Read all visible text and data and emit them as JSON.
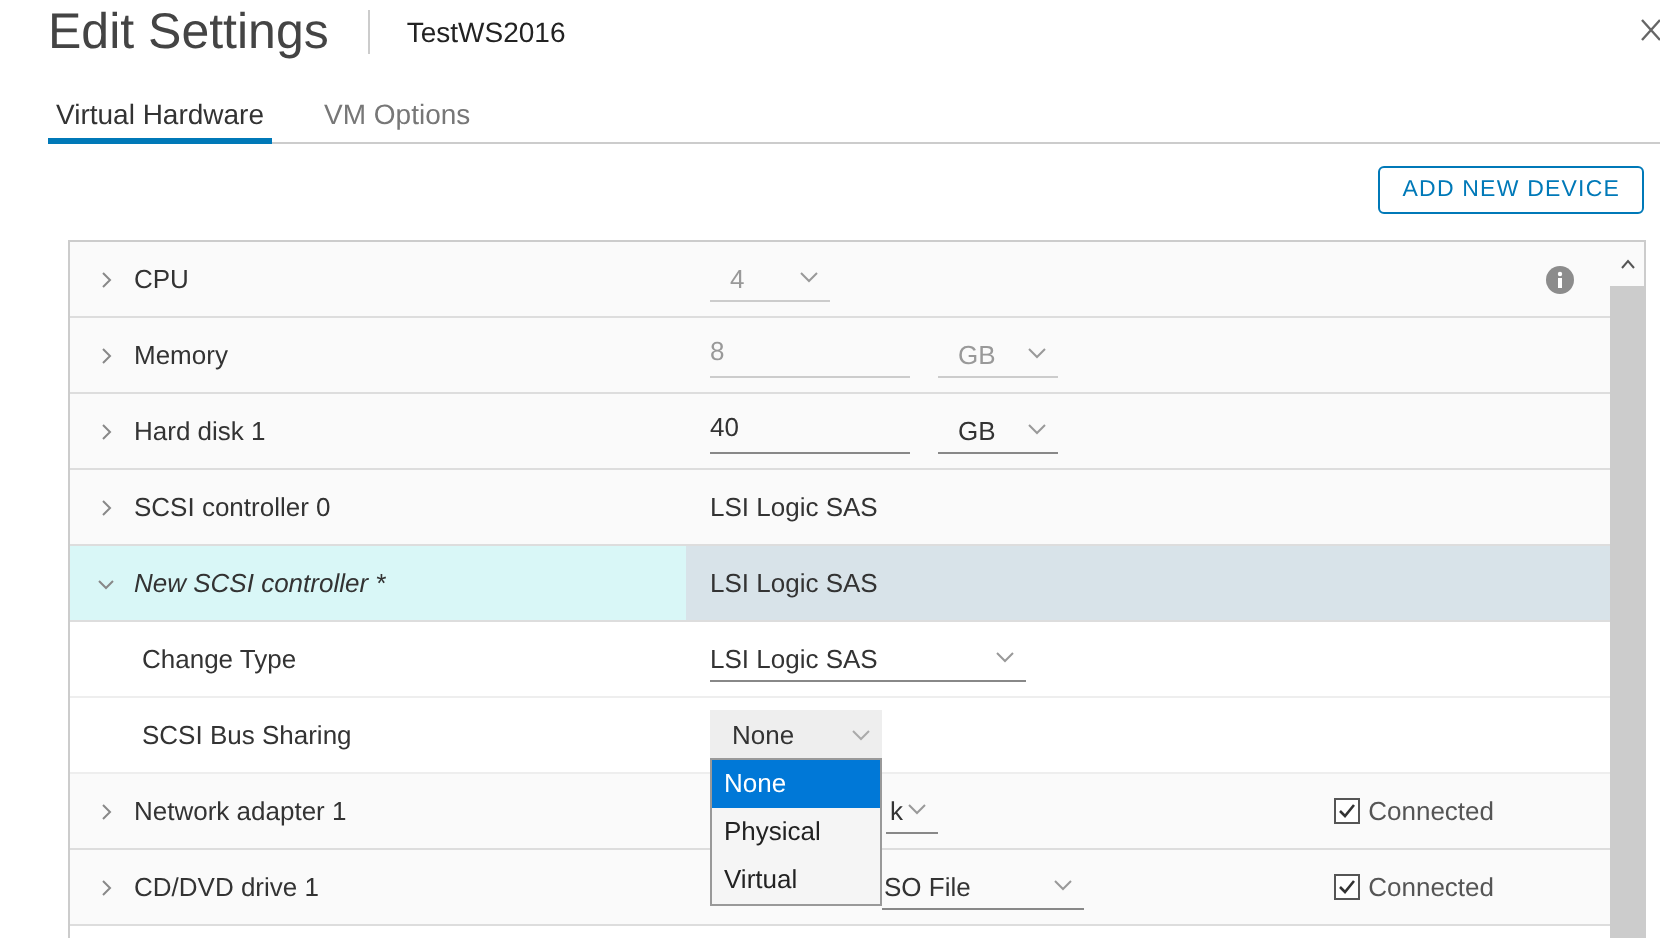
{
  "window": {
    "title": "Edit Settings",
    "subtitle": "TestWS2016"
  },
  "tabs": [
    {
      "label": "Virtual Hardware",
      "selected": true
    },
    {
      "label": "VM Options",
      "selected": false
    }
  ],
  "add_button": "ADD NEW DEVICE",
  "rows": [
    {
      "kind": "select",
      "label": "CPU",
      "expanded": false,
      "value": "4",
      "disabled": true
    },
    {
      "kind": "size",
      "label": "Memory",
      "expanded": false,
      "value": "8",
      "unit": "GB",
      "disabled": true
    },
    {
      "kind": "size",
      "label": "Hard disk 1",
      "expanded": false,
      "value": "40",
      "unit": "GB",
      "disabled": false
    },
    {
      "kind": "text",
      "label": "SCSI controller 0",
      "expanded": false,
      "value": "LSI Logic SAS"
    },
    {
      "kind": "text",
      "label": "New SCSI controller *",
      "expanded": true,
      "selected": true,
      "value": "LSI Logic SAS",
      "children": [
        {
          "kind": "select",
          "label": "Change Type",
          "value": "LSI Logic SAS",
          "disabled": false
        },
        {
          "kind": "menu",
          "label": "SCSI Bus Sharing",
          "value": "None",
          "options": [
            {
              "label": "None",
              "selected": true
            },
            {
              "label": "Physical",
              "selected": false
            },
            {
              "label": "Virtual",
              "selected": false
            }
          ]
        }
      ]
    },
    {
      "kind": "select",
      "label": "Network adapter 1",
      "expanded": false,
      "value": "k",
      "disabled": false,
      "connected": {
        "label": "Connected",
        "checked": true
      }
    },
    {
      "kind": "select",
      "label": "CD/DVD drive 1",
      "expanded": false,
      "value": "SO File",
      "disabled": false,
      "connected": {
        "label": "Connected",
        "checked": true
      }
    }
  ]
}
